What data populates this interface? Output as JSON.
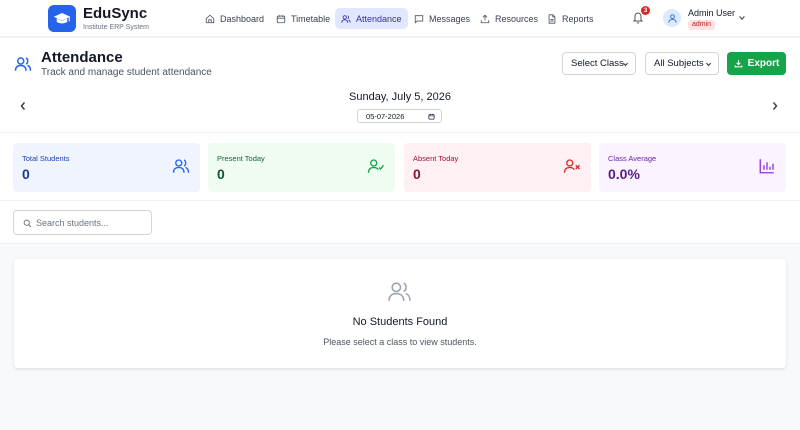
{
  "brand": {
    "name": "EduSync",
    "subtitle": "Institute ERP System"
  },
  "nav": [
    {
      "label": "Dashboard",
      "icon": "home-icon",
      "active": false
    },
    {
      "label": "Timetable",
      "icon": "calendar-icon",
      "active": false
    },
    {
      "label": "Attendance",
      "icon": "users-icon",
      "active": true
    },
    {
      "label": "Messages",
      "icon": "message-icon",
      "active": false
    },
    {
      "label": "Resources",
      "icon": "upload-icon",
      "active": false
    },
    {
      "label": "Reports",
      "icon": "file-icon",
      "active": false
    }
  ],
  "notifications": {
    "count": "3"
  },
  "user": {
    "name": "Admin User",
    "role": "admin"
  },
  "page": {
    "title": "Attendance",
    "subtitle": "Track and manage student attendance"
  },
  "filters": {
    "class_select": "Select Class",
    "subject_select": "All Subjects",
    "export_label": "Export"
  },
  "date": {
    "label": "Sunday, July 5, 2026",
    "input_value": "05-07-2026"
  },
  "stats": [
    {
      "label": "Total Students",
      "value": "0"
    },
    {
      "label": "Present Today",
      "value": "0"
    },
    {
      "label": "Absent Today",
      "value": "0"
    },
    {
      "label": "Class Average",
      "value": "0.0%"
    }
  ],
  "search": {
    "placeholder": "Search students..."
  },
  "empty_state": {
    "title": "No Students Found",
    "message": "Please select a class to view students."
  },
  "colors": {
    "primary": "#2563eb",
    "export": "#16a34a",
    "active_nav_bg": "#e0e7ff",
    "total_bg": "#eff4ff",
    "present_bg": "#effcf2",
    "absent_bg": "#fff1f3",
    "average_bg": "#fbf3ff"
  }
}
